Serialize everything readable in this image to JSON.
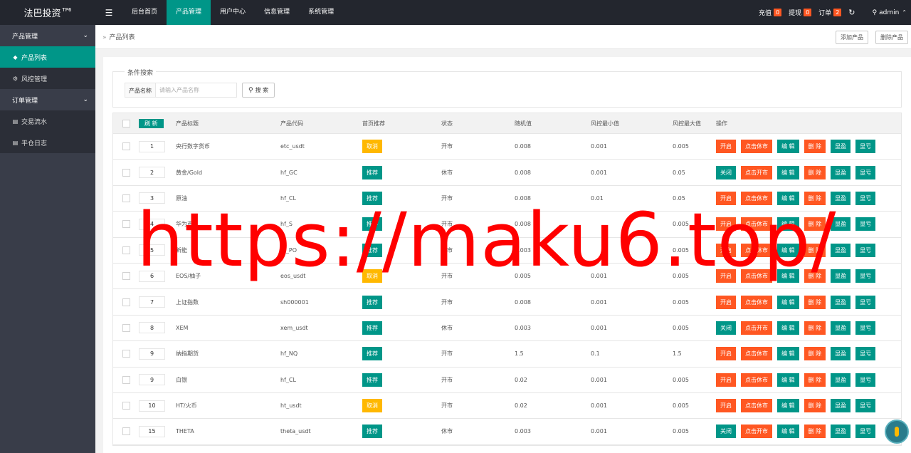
{
  "app": {
    "logo": "法巴投资",
    "version": "TP6",
    "menu_icon": "menu-icon"
  },
  "topnav": [
    {
      "label": "后台首页",
      "active": false
    },
    {
      "label": "产品管理",
      "active": true
    },
    {
      "label": "用户中心",
      "active": false
    },
    {
      "label": "信息管理",
      "active": false
    },
    {
      "label": "系统管理",
      "active": false
    }
  ],
  "top_right": {
    "recharge": {
      "label": "充值",
      "count": "0"
    },
    "withdraw": {
      "label": "提现",
      "count": "0"
    },
    "orders": {
      "label": "订单",
      "count": "2"
    },
    "user": "admin"
  },
  "sidebar": [
    {
      "type": "group",
      "label": "产品管理"
    },
    {
      "type": "item",
      "label": "产品列表",
      "icon": "cubes-icon",
      "active": true
    },
    {
      "type": "item",
      "label": "风控管理",
      "icon": "gear-icon",
      "active": false
    },
    {
      "type": "group",
      "label": "订单管理"
    },
    {
      "type": "item",
      "label": "交易流水",
      "icon": "document-icon",
      "active": false
    },
    {
      "type": "item",
      "label": "平仓日志",
      "icon": "document-icon",
      "active": false
    }
  ],
  "breadcrumb": "产品列表",
  "actions": {
    "add": "添加产品",
    "delete": "删除产品"
  },
  "search": {
    "legend": "条件搜索",
    "label": "产品名称",
    "placeholder": "请输入产品名称",
    "button": "搜 索"
  },
  "table": {
    "refresh": "刷 新",
    "headers": [
      "产品标题",
      "产品代码",
      "首页推荐",
      "状态",
      "随机值",
      "风控最小值",
      "风控最大值",
      "操作"
    ],
    "rows": [
      {
        "sort": "1",
        "title": "央行数字货币",
        "code": "etc_usdt",
        "rec": "取消",
        "rec_color": "yellow",
        "status": "开市",
        "rand": "0.008",
        "min": "0.001",
        "max": "0.005",
        "toggle": "开启",
        "market": "点击休市",
        "toggle_color": "orange"
      },
      {
        "sort": "2",
        "title": "黄金/Gold",
        "code": "hf_GC",
        "rec": "推荐",
        "rec_color": "green",
        "status": "休市",
        "rand": "0.008",
        "min": "0.001",
        "max": "0.05",
        "toggle": "关闭",
        "market": "点击开市",
        "toggle_color": "green"
      },
      {
        "sort": "3",
        "title": "原油",
        "code": "hf_CL",
        "rec": "推荐",
        "rec_color": "green",
        "status": "开市",
        "rand": "0.008",
        "min": "0.01",
        "max": "0.05",
        "toggle": "开启",
        "market": "点击休市",
        "toggle_color": "orange"
      },
      {
        "sort": "4",
        "title": "华为币",
        "code": "hf_S",
        "rec": "推荐",
        "rec_color": "green",
        "status": "开市",
        "rand": "0.008",
        "min": "",
        "max": "0.005",
        "toggle": "开启",
        "market": "点击休市",
        "toggle_color": "orange"
      },
      {
        "sort": "5",
        "title": "新能",
        "code": "hf_PO",
        "rec": "推荐",
        "rec_color": "green",
        "status": "开市",
        "rand": "0.003",
        "min": "",
        "max": "0.005",
        "toggle": "开启",
        "market": "点击休市",
        "toggle_color": "orange"
      },
      {
        "sort": "6",
        "title": "EOS/柚子",
        "code": "eos_usdt",
        "rec": "取消",
        "rec_color": "yellow",
        "status": "开市",
        "rand": "0.005",
        "min": "0.001",
        "max": "0.005",
        "toggle": "开启",
        "market": "点击休市",
        "toggle_color": "orange"
      },
      {
        "sort": "7",
        "title": "上证指数",
        "code": "sh000001",
        "rec": "推荐",
        "rec_color": "green",
        "status": "开市",
        "rand": "0.008",
        "min": "0.001",
        "max": "0.005",
        "toggle": "开启",
        "market": "点击休市",
        "toggle_color": "orange"
      },
      {
        "sort": "8",
        "title": "XEM",
        "code": "xem_usdt",
        "rec": "推荐",
        "rec_color": "green",
        "status": "休市",
        "rand": "0.003",
        "min": "0.001",
        "max": "0.005",
        "toggle": "关闭",
        "market": "点击开市",
        "toggle_color": "green"
      },
      {
        "sort": "9",
        "title": "纳指期货",
        "code": "hf_NQ",
        "rec": "推荐",
        "rec_color": "green",
        "status": "开市",
        "rand": "1.5",
        "min": "0.1",
        "max": "1.5",
        "toggle": "开启",
        "market": "点击休市",
        "toggle_color": "orange"
      },
      {
        "sort": "9",
        "title": "白银",
        "code": "hf_CL",
        "rec": "推荐",
        "rec_color": "green",
        "status": "开市",
        "rand": "0.02",
        "min": "0.001",
        "max": "0.005",
        "toggle": "开启",
        "market": "点击休市",
        "toggle_color": "orange"
      },
      {
        "sort": "10",
        "title": "HT/火币",
        "code": "ht_usdt",
        "rec": "取消",
        "rec_color": "yellow",
        "status": "开市",
        "rand": "0.02",
        "min": "0.001",
        "max": "0.005",
        "toggle": "开启",
        "market": "点击休市",
        "toggle_color": "orange"
      },
      {
        "sort": "15",
        "title": "THETA",
        "code": "theta_usdt",
        "rec": "推荐",
        "rec_color": "green",
        "status": "休市",
        "rand": "0.003",
        "min": "0.001",
        "max": "0.005",
        "toggle": "关闭",
        "market": "点击开市",
        "toggle_color": "green"
      }
    ],
    "ops": {
      "edit": "编 辑",
      "delete": "删 除",
      "profit": "显盈",
      "loss": "显亏"
    }
  },
  "watermark": "https://maku6.top/",
  "colors": {
    "primary": "#009688",
    "danger": "#ff5722",
    "warn": "#ffb800",
    "nav": "#23262e",
    "side": "#393d49"
  }
}
